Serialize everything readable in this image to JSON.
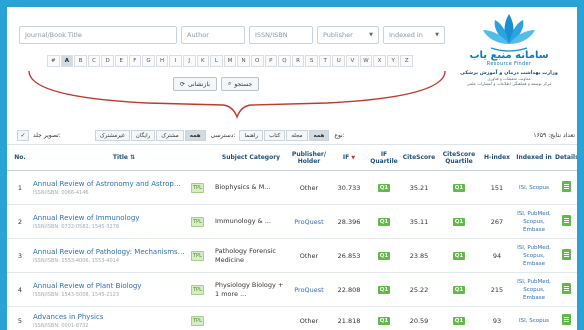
{
  "search": {
    "journal_placeholder": "Journal/Book Title",
    "author_placeholder": "Author",
    "issn_placeholder": "ISSN/ISBN",
    "publisher_select": "Publisher",
    "indexed_select": "Indexed in",
    "search_button": "جستجو",
    "reset_button": "بازنشانی"
  },
  "alphabet": [
    "#",
    "A",
    "B",
    "C",
    "D",
    "E",
    "F",
    "G",
    "H",
    "I",
    "J",
    "K",
    "L",
    "M",
    "N",
    "O",
    "P",
    "Q",
    "R",
    "S",
    "T",
    "U",
    "V",
    "W",
    "X",
    "Y",
    "Z"
  ],
  "alphabet_active": "A",
  "logo": {
    "title": "سامانه منبع یاب",
    "subtitle": "Resource Finder",
    "ministry": "وزارت بهداشت درمان و آموزش پزشکی",
    "line2": "معاونت تحقیقات و فناوری",
    "line3": "مرکز توسعه و هماهنگی اطلاعات و انتشارات علمی"
  },
  "toolbar": {
    "results_label": "تعداد نتایج: ۱۶۵۹",
    "type_label": "نوع:",
    "type_options": [
      "همه",
      "مجله",
      "کتاب"
    ],
    "type_guide": "راهنما",
    "access_label": "دسترسی:",
    "access_options": [
      "همه",
      "مشترک",
      "رایگان",
      "غیرمشترک"
    ],
    "image_label": "تصویر جلد:"
  },
  "columns": {
    "no": "No.",
    "title": "Title",
    "subject": "Subject Category",
    "publisher": "Publisher/ Holder",
    "if": "IF",
    "ifq": "IF Quartile",
    "citescore": "CiteScore",
    "csq": "CiteScore Quartile",
    "hindex": "H-index",
    "indexed": "Indexed in",
    "details": "Details"
  },
  "rows": [
    {
      "no": "1",
      "title": "Annual Review of Astronomy and Astrophy...",
      "issn": "ISSN/ISBN: 0066-4146",
      "tp": "TPL",
      "subject": "Biophysics & M...",
      "publisher": "Other",
      "if": "30.733",
      "ifq": "Q1",
      "citescore": "35.21",
      "csq": "Q1",
      "hindex": "151",
      "indexed": "ISI, Scopus"
    },
    {
      "no": "2",
      "title": "Annual Review of Immunology",
      "issn": "ISSN/ISBN: 0732-0582, 1545-3278",
      "tp": "TPL",
      "subject": "Immunology & ...",
      "publisher": "ProQuest",
      "if": "28.396",
      "ifq": "Q1",
      "citescore": "35.11",
      "csq": "Q1",
      "hindex": "267",
      "indexed": "ISI, PubMed, Scopus, Embase"
    },
    {
      "no": "3",
      "title": "Annual Review of Pathology: Mechanisms ...",
      "issn": "ISSN/ISBN: 1553-4006, 1553-4014",
      "tp": "TPL",
      "subject": "Pathology Forensic Medicine",
      "publisher": "Other",
      "if": "26.853",
      "ifq": "Q1",
      "citescore": "23.85",
      "csq": "Q1",
      "hindex": "94",
      "indexed": "ISI, PubMed, Scopus, Embase"
    },
    {
      "no": "4",
      "title": "Annual Review of Plant Biology",
      "issn": "ISSN/ISBN: 1543-5008, 1545-2123",
      "tp": "TPL",
      "subject": "Physiology Biology + 1 more ...",
      "publisher": "ProQuest",
      "if": "22.808",
      "ifq": "Q1",
      "citescore": "25.22",
      "csq": "Q1",
      "hindex": "215",
      "indexed": "ISI, PubMed, Scopus, Embase"
    },
    {
      "no": "5",
      "title": "Advances in Physics",
      "issn": "ISSN/ISBN: 0001-8732",
      "tp": "TPL",
      "subject": "",
      "publisher": "Other",
      "if": "21.818",
      "ifq": "Q1",
      "citescore": "20.59",
      "csq": "Q1",
      "hindex": "93",
      "indexed": "ISI, Scopus"
    }
  ],
  "colors": {
    "accent": "#29a3d6",
    "link": "#2c6fb5",
    "quartile": "#5dbb46",
    "arc": "#c0392b"
  }
}
